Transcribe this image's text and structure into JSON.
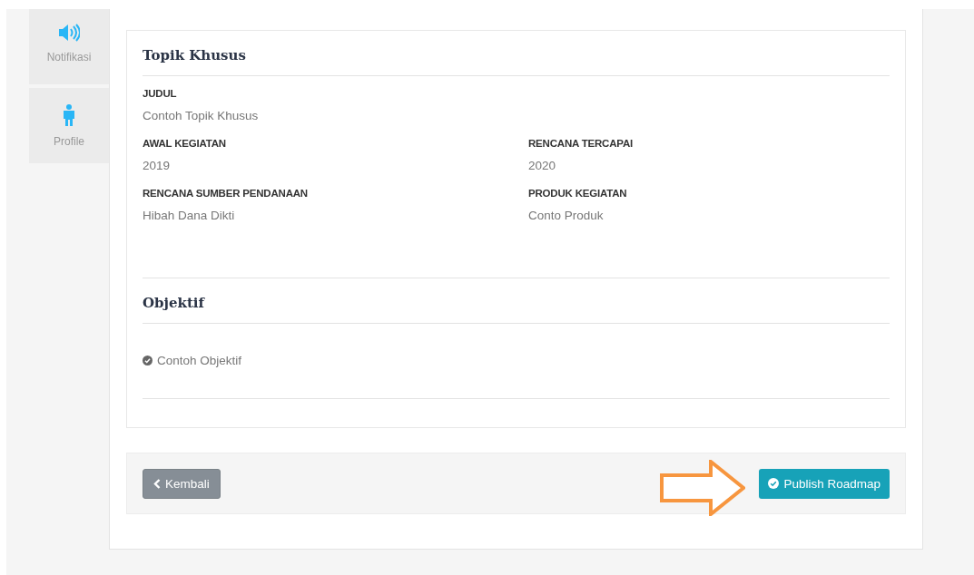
{
  "sidebar": {
    "items": [
      {
        "label": "Notifikasi",
        "kind": "speaker"
      },
      {
        "label": "Profile",
        "kind": "person"
      }
    ]
  },
  "topic": {
    "title": "Topik Khusus",
    "fields": [
      {
        "label": "JUDUL",
        "value": "Contoh Topik Khusus",
        "kind": "full"
      },
      {
        "label": "AWAL KEGIATAN",
        "value": "2019",
        "kind": "half"
      },
      {
        "label": "RENCANA TERCAPAI",
        "value": "2020",
        "kind": "half"
      },
      {
        "label": "RENCANA SUMBER PENDANAAN",
        "value": "Hibah Dana Dikti",
        "kind": "half"
      },
      {
        "label": "PRODUK KEGIATAN",
        "value": "Conto Produk",
        "kind": "half"
      }
    ]
  },
  "objective": {
    "title": "Objektif",
    "items": [
      "Contoh Objektif"
    ]
  },
  "footer": {
    "back_button": "Kembali",
    "publish_button": "Publish Roadmap"
  }
}
